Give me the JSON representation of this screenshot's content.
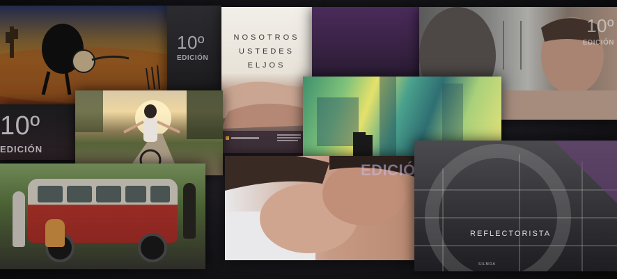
{
  "collage": {
    "edition_number_left": "10º",
    "edition_word_left": "EDICIÓN",
    "edition_number_mid": "10º",
    "edition_word_mid": "EDICIÓN",
    "edition_number_right": "10º",
    "edition_word_right": "EDICIÓN",
    "edition_word_center": "EDICIÓN",
    "poster_line1": "NOSOTROS",
    "poster_line2": "USTEDES",
    "poster_line3": "ELJOS",
    "reflectorista_title": "REFLECTORISTA",
    "reflectorista_sub": "SILMOA"
  },
  "icons": {
    "poster_logo": "logo-mark"
  }
}
